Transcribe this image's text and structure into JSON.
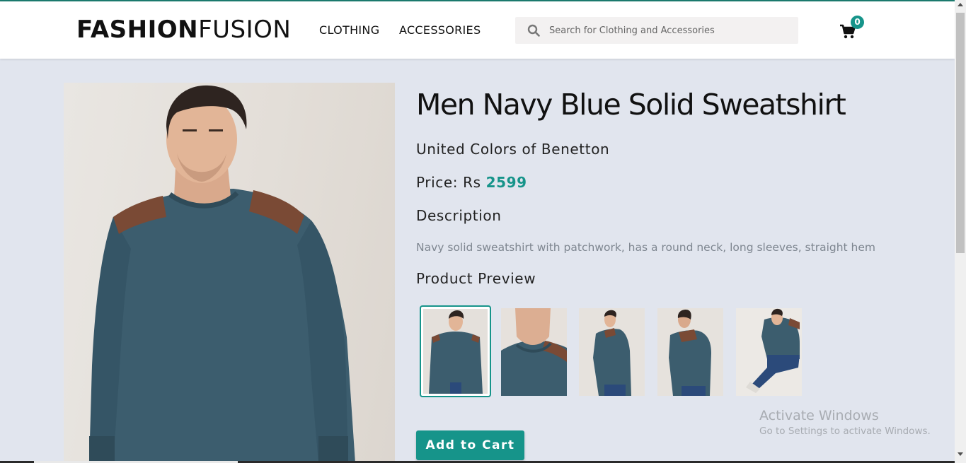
{
  "header": {
    "logo_bold": "FASHION",
    "logo_light": "FUSION",
    "nav": [
      {
        "label": "CLOTHING"
      },
      {
        "label": "ACCESSORIES"
      }
    ],
    "search_placeholder": "Search for Clothing and Accessories",
    "cart_count": "0"
  },
  "product": {
    "title": "Men Navy Blue Solid Sweatshirt",
    "brand": "United Colors of Benetton",
    "price_label": "Price: Rs",
    "price_value": "2599",
    "description_heading": "Description",
    "description": "Navy solid sweatshirt with patchwork, has a round neck, long sleeves, straight hem",
    "preview_heading": "Product Preview",
    "preview_selected_index": 0,
    "add_to_cart_label": "Add to Cart"
  },
  "os_watermark": {
    "title": "Activate Windows",
    "subtitle": "Go to Settings to activate Windows."
  },
  "colors": {
    "accent": "#16948a",
    "page_bg": "#e1e5ee",
    "sweater": "#3c5d6e",
    "leather_patch": "#7a4a35"
  }
}
